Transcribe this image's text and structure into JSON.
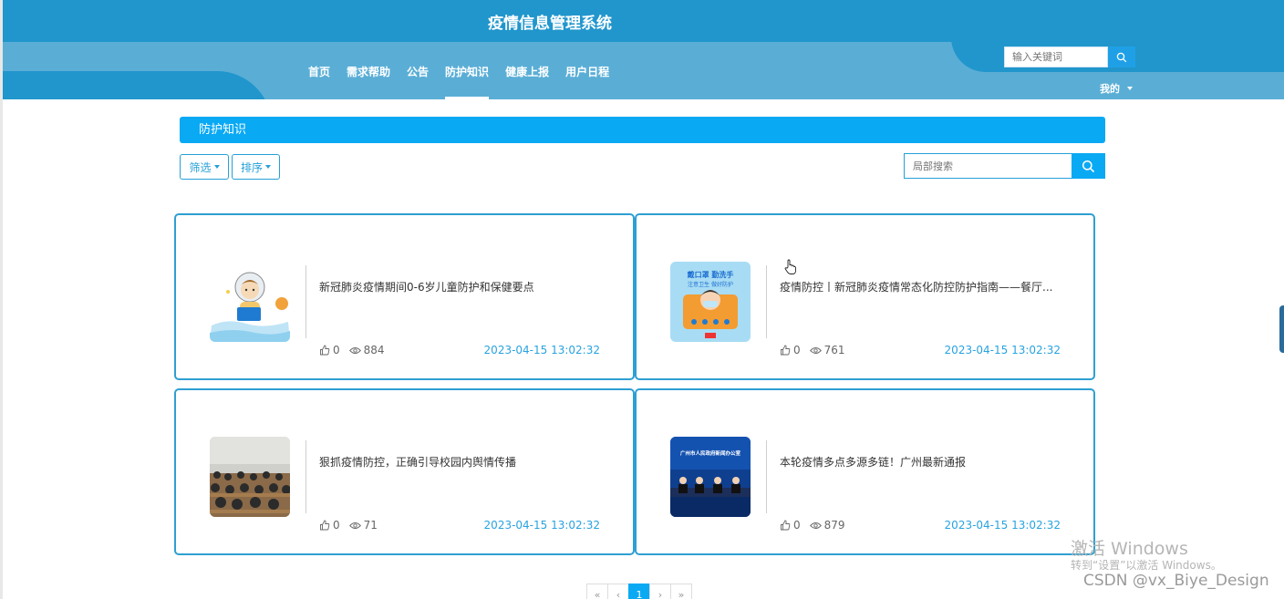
{
  "header": {
    "site_title": "疫情信息管理系统",
    "nav": [
      {
        "label": "首页",
        "active": false
      },
      {
        "label": "需求帮助",
        "active": false
      },
      {
        "label": "公告",
        "active": false
      },
      {
        "label": "防护知识",
        "active": true
      },
      {
        "label": "健康上报",
        "active": false
      },
      {
        "label": "用户日程",
        "active": false
      }
    ],
    "search_placeholder": "输入关键词",
    "user_menu_label": "我的"
  },
  "page": {
    "section_title": "防护知识",
    "filter_label": "筛选",
    "sort_label": "排序",
    "local_search_placeholder": "局部搜索"
  },
  "cards": [
    {
      "title": "新冠肺炎疫情期间0-6岁儿童防护和保健要点",
      "likes": "0",
      "views": "884",
      "date": "2023-04-15 13:02:32",
      "thumb": "cartoon-child-astronaut"
    },
    {
      "title": "疫情防控丨新冠肺炎疫情常态化防控防护指南——餐厅...",
      "likes": "0",
      "views": "761",
      "date": "2023-04-15 13:02:32",
      "thumb": "mask-poster",
      "poster_line1": "戴口罩 勤洗手",
      "poster_line2": "注意卫生 做好防护"
    },
    {
      "title": "狠抓疫情防控，正确引导校园内舆情传播",
      "likes": "0",
      "views": "71",
      "date": "2023-04-15 13:02:32",
      "thumb": "meeting-photo"
    },
    {
      "title": "本轮疫情多点多源多链！广州最新通报",
      "likes": "0",
      "views": "879",
      "date": "2023-04-15 13:02:32",
      "thumb": "press-conference-photo",
      "banner": "广州市人民政府新闻办公室"
    }
  ],
  "pagination": {
    "first": "«",
    "prev": "‹",
    "current": "1",
    "next": "›",
    "last": "»"
  },
  "overlay": {
    "activate_title": "激活 Windows",
    "activate_sub": "转到“设置”以激活 Windows。",
    "csdn": "CSDN @vx_Biye_Design"
  },
  "colors": {
    "primary": "#0aa9f4",
    "header": "#2196cc",
    "header_light": "#5aaed6",
    "card_border": "#2e9fd2",
    "date": "#28a3e0"
  },
  "icons": [
    "search-icon",
    "thumbs-up-icon",
    "eye-icon",
    "caret-down-icon",
    "hand-cursor-icon"
  ]
}
